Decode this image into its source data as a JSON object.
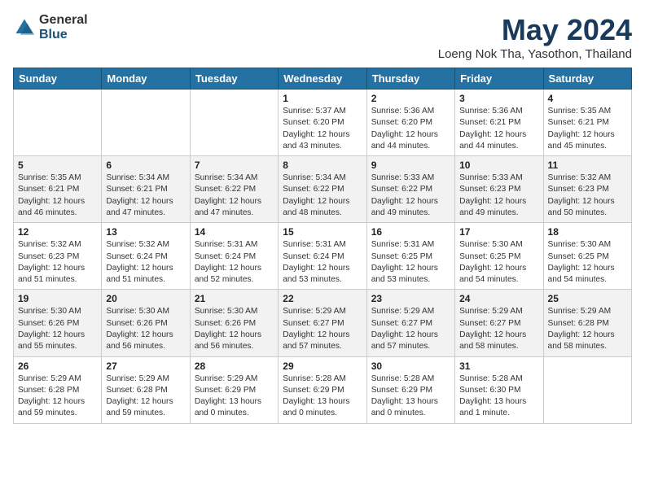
{
  "logo": {
    "general": "General",
    "blue": "Blue"
  },
  "title": "May 2024",
  "location": "Loeng Nok Tha, Yasothon, Thailand",
  "days_of_week": [
    "Sunday",
    "Monday",
    "Tuesday",
    "Wednesday",
    "Thursday",
    "Friday",
    "Saturday"
  ],
  "weeks": [
    [
      {
        "day": "",
        "info": ""
      },
      {
        "day": "",
        "info": ""
      },
      {
        "day": "",
        "info": ""
      },
      {
        "day": "1",
        "info": "Sunrise: 5:37 AM\nSunset: 6:20 PM\nDaylight: 12 hours\nand 43 minutes."
      },
      {
        "day": "2",
        "info": "Sunrise: 5:36 AM\nSunset: 6:20 PM\nDaylight: 12 hours\nand 44 minutes."
      },
      {
        "day": "3",
        "info": "Sunrise: 5:36 AM\nSunset: 6:21 PM\nDaylight: 12 hours\nand 44 minutes."
      },
      {
        "day": "4",
        "info": "Sunrise: 5:35 AM\nSunset: 6:21 PM\nDaylight: 12 hours\nand 45 minutes."
      }
    ],
    [
      {
        "day": "5",
        "info": "Sunrise: 5:35 AM\nSunset: 6:21 PM\nDaylight: 12 hours\nand 46 minutes."
      },
      {
        "day": "6",
        "info": "Sunrise: 5:34 AM\nSunset: 6:21 PM\nDaylight: 12 hours\nand 47 minutes."
      },
      {
        "day": "7",
        "info": "Sunrise: 5:34 AM\nSunset: 6:22 PM\nDaylight: 12 hours\nand 47 minutes."
      },
      {
        "day": "8",
        "info": "Sunrise: 5:34 AM\nSunset: 6:22 PM\nDaylight: 12 hours\nand 48 minutes."
      },
      {
        "day": "9",
        "info": "Sunrise: 5:33 AM\nSunset: 6:22 PM\nDaylight: 12 hours\nand 49 minutes."
      },
      {
        "day": "10",
        "info": "Sunrise: 5:33 AM\nSunset: 6:23 PM\nDaylight: 12 hours\nand 49 minutes."
      },
      {
        "day": "11",
        "info": "Sunrise: 5:32 AM\nSunset: 6:23 PM\nDaylight: 12 hours\nand 50 minutes."
      }
    ],
    [
      {
        "day": "12",
        "info": "Sunrise: 5:32 AM\nSunset: 6:23 PM\nDaylight: 12 hours\nand 51 minutes."
      },
      {
        "day": "13",
        "info": "Sunrise: 5:32 AM\nSunset: 6:24 PM\nDaylight: 12 hours\nand 51 minutes."
      },
      {
        "day": "14",
        "info": "Sunrise: 5:31 AM\nSunset: 6:24 PM\nDaylight: 12 hours\nand 52 minutes."
      },
      {
        "day": "15",
        "info": "Sunrise: 5:31 AM\nSunset: 6:24 PM\nDaylight: 12 hours\nand 53 minutes."
      },
      {
        "day": "16",
        "info": "Sunrise: 5:31 AM\nSunset: 6:25 PM\nDaylight: 12 hours\nand 53 minutes."
      },
      {
        "day": "17",
        "info": "Sunrise: 5:30 AM\nSunset: 6:25 PM\nDaylight: 12 hours\nand 54 minutes."
      },
      {
        "day": "18",
        "info": "Sunrise: 5:30 AM\nSunset: 6:25 PM\nDaylight: 12 hours\nand 54 minutes."
      }
    ],
    [
      {
        "day": "19",
        "info": "Sunrise: 5:30 AM\nSunset: 6:26 PM\nDaylight: 12 hours\nand 55 minutes."
      },
      {
        "day": "20",
        "info": "Sunrise: 5:30 AM\nSunset: 6:26 PM\nDaylight: 12 hours\nand 56 minutes."
      },
      {
        "day": "21",
        "info": "Sunrise: 5:30 AM\nSunset: 6:26 PM\nDaylight: 12 hours\nand 56 minutes."
      },
      {
        "day": "22",
        "info": "Sunrise: 5:29 AM\nSunset: 6:27 PM\nDaylight: 12 hours\nand 57 minutes."
      },
      {
        "day": "23",
        "info": "Sunrise: 5:29 AM\nSunset: 6:27 PM\nDaylight: 12 hours\nand 57 minutes."
      },
      {
        "day": "24",
        "info": "Sunrise: 5:29 AM\nSunset: 6:27 PM\nDaylight: 12 hours\nand 58 minutes."
      },
      {
        "day": "25",
        "info": "Sunrise: 5:29 AM\nSunset: 6:28 PM\nDaylight: 12 hours\nand 58 minutes."
      }
    ],
    [
      {
        "day": "26",
        "info": "Sunrise: 5:29 AM\nSunset: 6:28 PM\nDaylight: 12 hours\nand 59 minutes."
      },
      {
        "day": "27",
        "info": "Sunrise: 5:29 AM\nSunset: 6:28 PM\nDaylight: 12 hours\nand 59 minutes."
      },
      {
        "day": "28",
        "info": "Sunrise: 5:29 AM\nSunset: 6:29 PM\nDaylight: 13 hours\nand 0 minutes."
      },
      {
        "day": "29",
        "info": "Sunrise: 5:28 AM\nSunset: 6:29 PM\nDaylight: 13 hours\nand 0 minutes."
      },
      {
        "day": "30",
        "info": "Sunrise: 5:28 AM\nSunset: 6:29 PM\nDaylight: 13 hours\nand 0 minutes."
      },
      {
        "day": "31",
        "info": "Sunrise: 5:28 AM\nSunset: 6:30 PM\nDaylight: 13 hours\nand 1 minute."
      },
      {
        "day": "",
        "info": ""
      }
    ]
  ]
}
